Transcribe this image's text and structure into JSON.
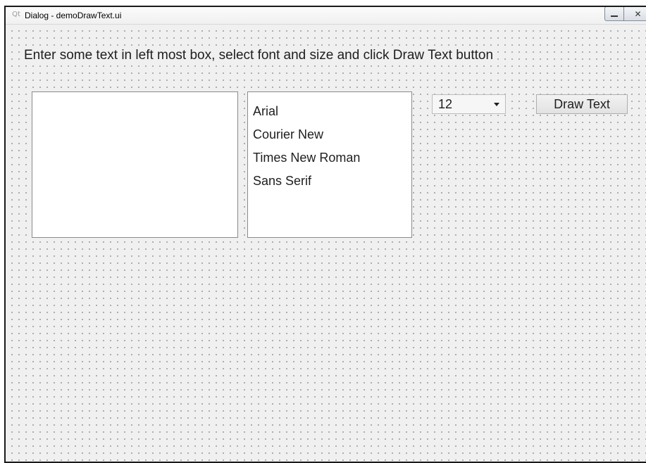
{
  "window": {
    "title": "Dialog - demoDrawText.ui",
    "app_icon": "qt-icon",
    "minimize_icon": "minimize-icon",
    "close_icon": "close-icon",
    "close_glyph": "✕"
  },
  "instruction": "Enter some text in left most box, select font and size and click Draw Text button",
  "text_input": {
    "value": ""
  },
  "font_list": {
    "items": [
      "Arial",
      "Courier New",
      "Times New Roman",
      "Sans Serif"
    ]
  },
  "size_select": {
    "selected": "12"
  },
  "draw_button": {
    "label": "Draw Text"
  },
  "colors": {
    "window_background": "#f0f0f0",
    "grid_dots": "#9a9a9a",
    "text": "#1e1e1e"
  }
}
